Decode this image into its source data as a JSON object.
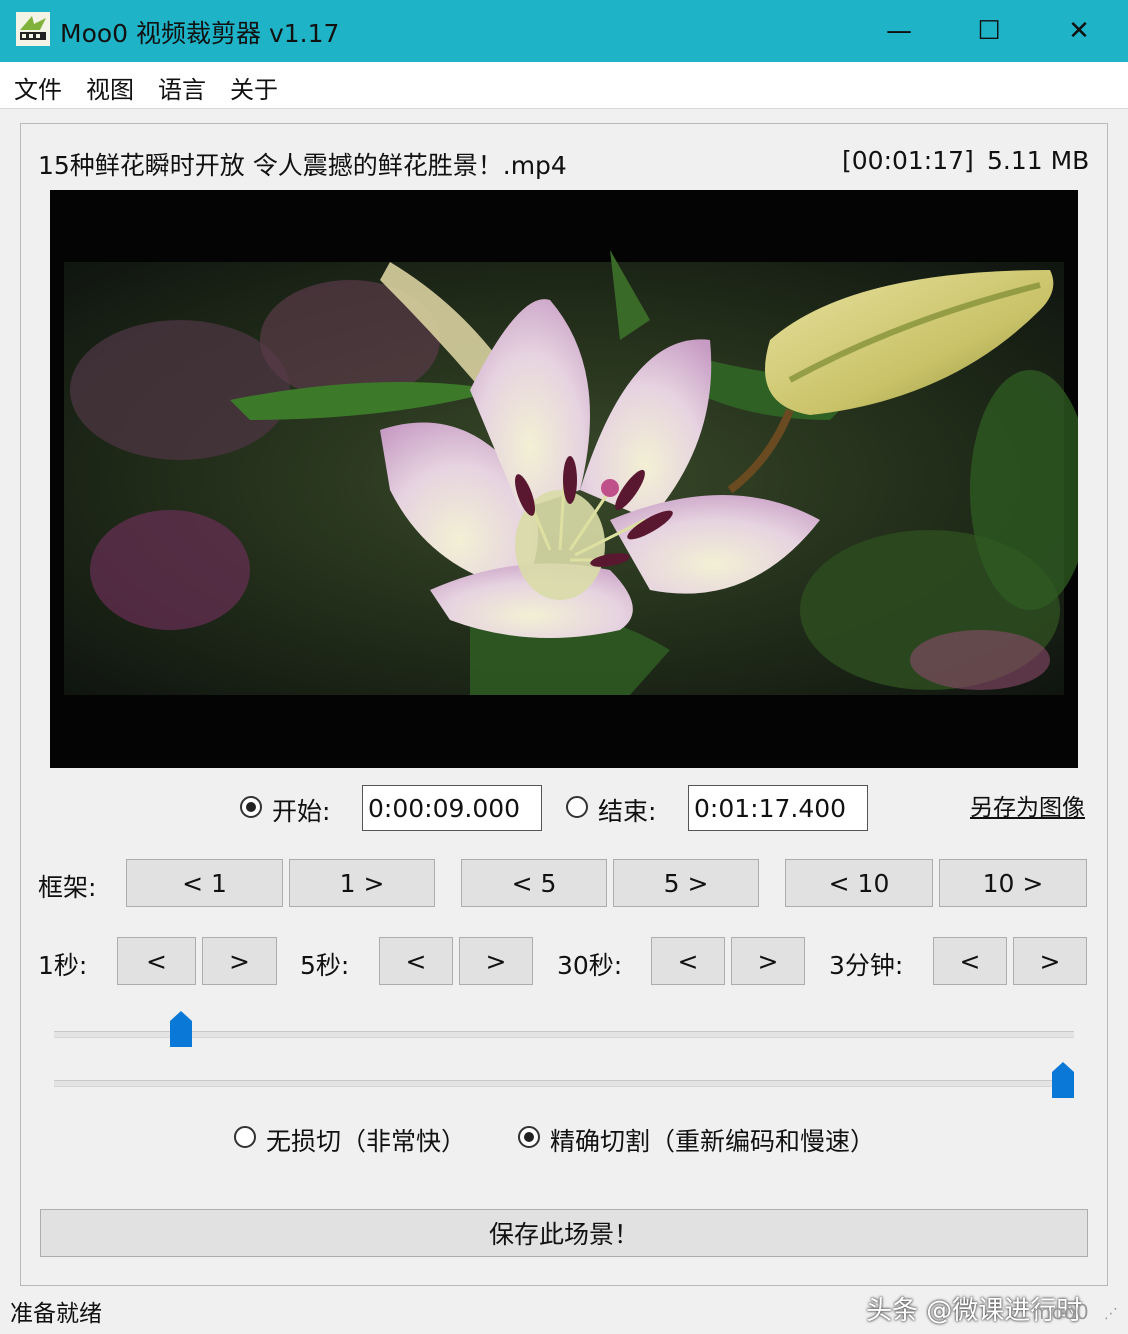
{
  "window": {
    "title": "Moo0 视频裁剪器 v1.17",
    "minimize_glyph": "—",
    "maximize_glyph": "☐",
    "close_glyph": "✕"
  },
  "menu": [
    "文件",
    "视图",
    "语言",
    "关于"
  ],
  "file": {
    "name": "15种鲜花瞬时开放 令人震撼的鲜花胜景！.mp4",
    "duration": "[00:01:17]",
    "size": "5.11 MB"
  },
  "range": {
    "start_label": "开始:",
    "start_value": "0:00:09.000",
    "start_selected": true,
    "end_label": "结束:",
    "end_value": "0:01:17.400",
    "end_selected": false,
    "save_image_link": "另存为图像"
  },
  "frames": {
    "label": "框架:",
    "buttons": [
      "< 1",
      "1 >",
      "< 5",
      "5 >",
      "< 10",
      "10 >"
    ]
  },
  "steps": [
    {
      "label": "1秒:",
      "back": "<",
      "forward": ">"
    },
    {
      "label": "5秒:",
      "back": "<",
      "forward": ">"
    },
    {
      "label": "30秒:",
      "back": "<",
      "forward": ">"
    },
    {
      "label": "3分钟:",
      "back": "<",
      "forward": ">"
    }
  ],
  "sliders": {
    "start_fraction": 0.116,
    "end_fraction": 1.0,
    "accent": "#0a78d7"
  },
  "mode": {
    "lossless_label": "无损切（非常快）",
    "lossless_selected": false,
    "precise_label": "精确切割（重新编码和慢速）",
    "precise_selected": true
  },
  "save_scene_button": "保存此场景！",
  "status": "准备就绪",
  "watermark": "头条 @微课进行时",
  "watermark_logo": "moo0",
  "colors": {
    "titlebar": "#1fb3c8",
    "window_bg": "#f0f0f0",
    "button_bg": "#e1e1e1"
  }
}
